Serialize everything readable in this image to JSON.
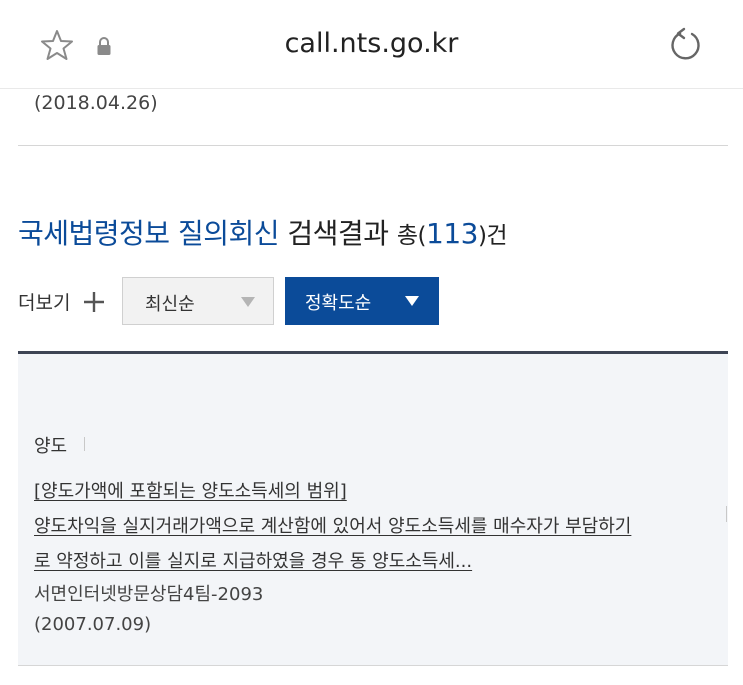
{
  "browser": {
    "url": "call.nts.go.kr",
    "icons": [
      "star-icon",
      "lock-icon",
      "reload-icon"
    ]
  },
  "previous_result": {
    "date": "(2018.04.26)"
  },
  "search": {
    "heading_title": "국세법령정보 질의회신",
    "heading_suffix": " 검색결과 ",
    "total_prefix": "총(",
    "total_count": "113",
    "total_suffix": ")건",
    "more_label": "더보기",
    "sort_latest": "최신순",
    "sort_accuracy": "정확도순"
  },
  "result": {
    "category": "양도",
    "title": "[양도가액에 포함되는 양도소득세의 범위]",
    "summary_line1": "양도차익을 실지거래가액으로 계산함에 있어서 양도소득세를 매수자가 부담하기",
    "summary_line2": "로 약정하고 이를 실지로 지급하였을 경우 동 양도소득세...",
    "doc_number": "서면인터넷방문상담4팀-2093",
    "date": "(2007.07.09)"
  },
  "colors": {
    "brand_blue": "#0b4b99",
    "panel_bg": "#f3f5f8",
    "panel_border": "#3d4454"
  }
}
